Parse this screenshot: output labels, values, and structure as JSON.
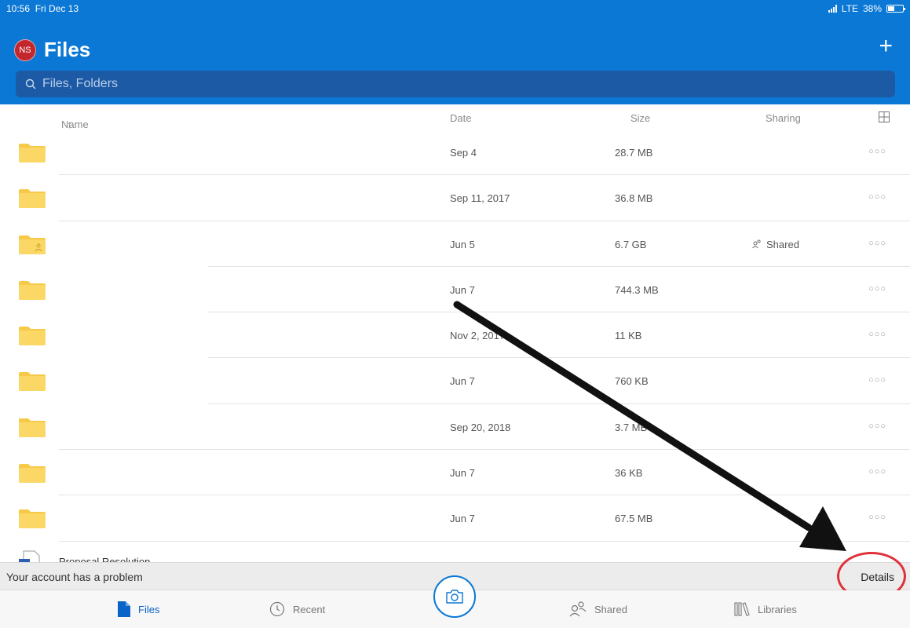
{
  "status": {
    "time": "10:56",
    "date": "Fri Dec 13",
    "network": "LTE",
    "battery": "38%",
    "battery_level": 0.38
  },
  "header": {
    "avatar_initials": "NS",
    "title": "Files",
    "add_icon": "plus-icon"
  },
  "search": {
    "placeholder": "Files, Folders",
    "value": ""
  },
  "columns": {
    "name": "Name",
    "sort": "↑",
    "date": "Date",
    "size": "Size",
    "sharing": "Sharing",
    "view_icon": "grid-icon"
  },
  "rows": [
    {
      "name": "",
      "date": "Sep 4",
      "size": "28.7 MB",
      "sharing": ""
    },
    {
      "name": "",
      "date": "Sep 11, 2017",
      "size": "36.8 MB",
      "sharing": ""
    },
    {
      "name": "",
      "date": "Jun 5",
      "size": "6.7 GB",
      "sharing": "Shared"
    },
    {
      "name": "",
      "date": "Jun 7",
      "size": "744.3 MB",
      "sharing": ""
    },
    {
      "name": "",
      "date": "Nov 2, 2017",
      "size": "11 KB",
      "sharing": ""
    },
    {
      "name": "",
      "date": "Jun 7",
      "size": "760 KB",
      "sharing": ""
    },
    {
      "name": "",
      "date": "Sep 20, 2018",
      "size": "3.7 MB",
      "sharing": ""
    },
    {
      "name": "",
      "date": "Jun 7",
      "size": "36 KB",
      "sharing": ""
    },
    {
      "name": "",
      "date": "Jun 7",
      "size": "67.5 MB",
      "sharing": ""
    }
  ],
  "partial_row": {
    "name": "Proposal Resolution"
  },
  "banner": {
    "message": "Your account has a problem",
    "action": "Details",
    "highlight_color": "#e0303a"
  },
  "tabs": {
    "files": "Files",
    "recent": "Recent",
    "shared": "Shared",
    "libraries": "Libraries"
  },
  "colors": {
    "accent": "#0a78d4",
    "folder": "#f7c948",
    "active_tab": "#0a64c8"
  }
}
